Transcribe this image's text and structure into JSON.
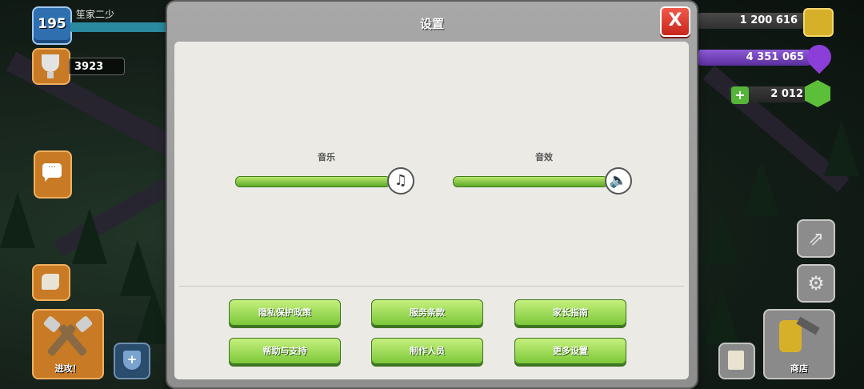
{
  "player": {
    "level": "195",
    "name": "笙家二少",
    "trophies": "3923"
  },
  "resources": {
    "gold": "1 200 616",
    "elixir": "4 351 065",
    "gems": "2 012"
  },
  "buttons": {
    "attack_label": "进攻！",
    "shop_label": "商店"
  },
  "icons": {
    "chat": "chat-icon",
    "settings": "gear-icon",
    "builder": "builder-icon",
    "music": "music-note-icon",
    "sound": "speaker-icon",
    "close": "close-icon"
  },
  "settings": {
    "title": "设置",
    "close_label": "X",
    "music_label": "音乐",
    "sfx_label": "音效",
    "music_level": 1.0,
    "sfx_level": 1.0,
    "menu": [
      "隐私保护政策",
      "服务条款",
      "家长指南",
      "帮助与支持",
      "制作人员",
      "更多设置"
    ]
  },
  "colors": {
    "accent_green": "#7cc83a",
    "close_red": "#c8261b",
    "panel_bg": "#ebeae4"
  }
}
